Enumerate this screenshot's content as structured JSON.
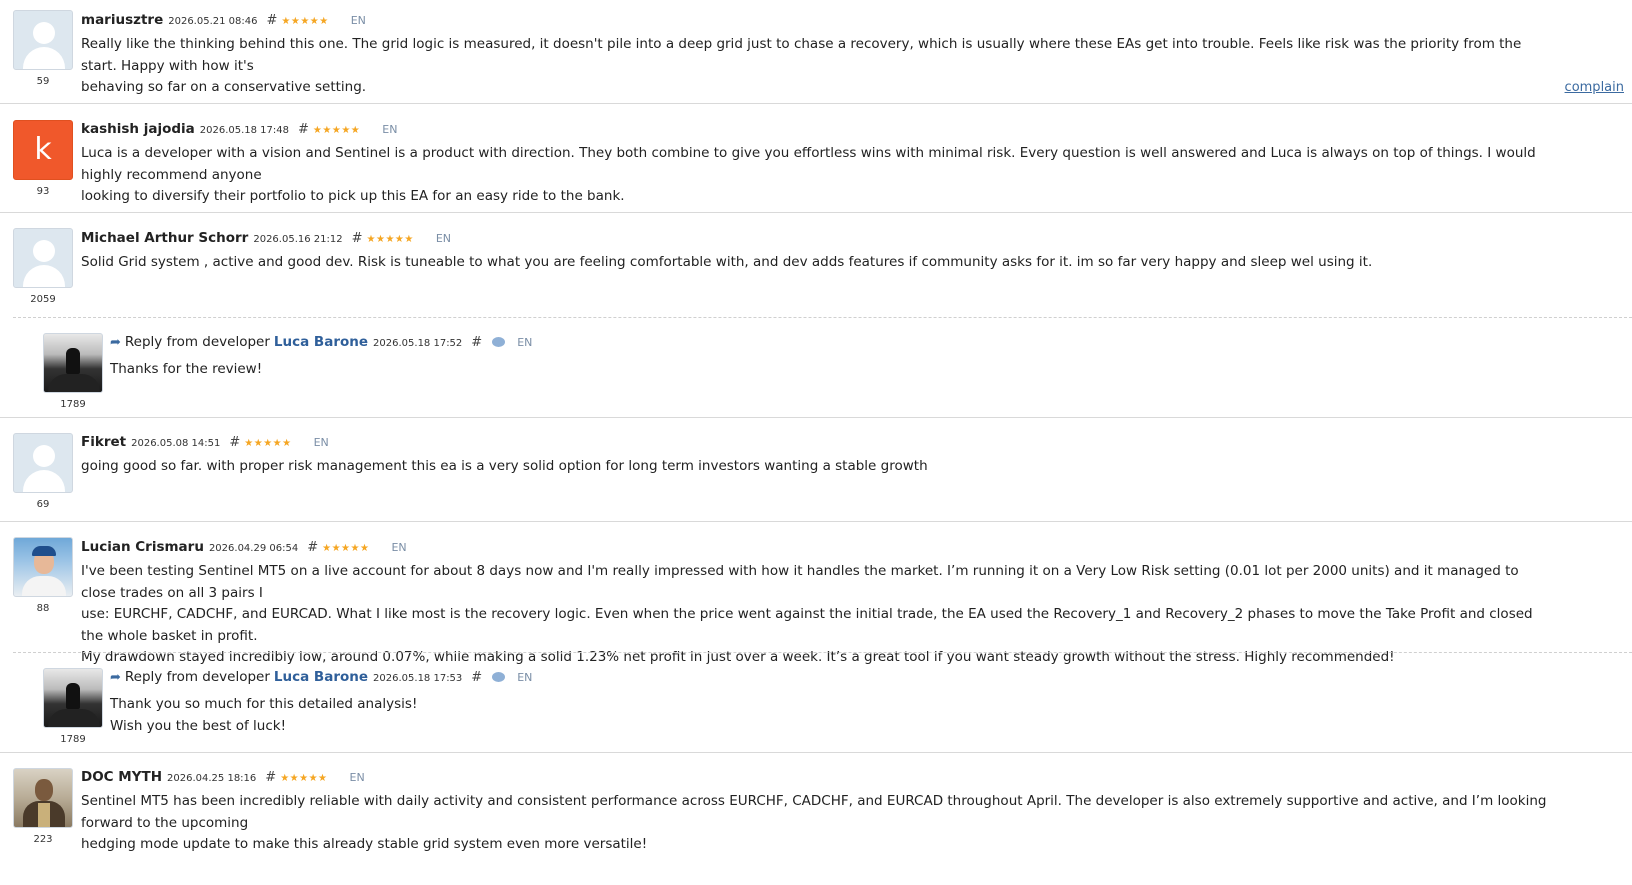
{
  "reviews": [
    {
      "author": "mariusztre",
      "date": "2026.05.21 08:46",
      "hash": "#",
      "stars": "★★★★★",
      "lang": "EN",
      "rating_count": "59",
      "avatar": "placeholder-user-icon",
      "lines": [
        "Really like the thinking behind this one. The grid logic is measured, it doesn't pile into a deep grid just to chase a recovery, which is usually where these EAs get into trouble. Feels like risk was the priority from the start. Happy with how it's",
        "behaving so far on a conservative setting."
      ],
      "complain_label": "complain"
    },
    {
      "author": "kashish jajodia",
      "date": "2026.05.18 17:48",
      "hash": "#",
      "stars": "★★★★★",
      "lang": "EN",
      "rating_count": "93",
      "avatar_letter": "k",
      "lines": [
        "Luca is a developer with a vision and Sentinel is a product with direction. They both combine to give you effortless wins with minimal risk. Every question is well answered and Luca is always on top of things. I would highly recommend anyone",
        "looking to diversify their portfolio to pick up this EA for an easy ride to the bank."
      ]
    },
    {
      "author": "Michael Arthur Schorr",
      "date": "2026.05.16 21:12",
      "hash": "#",
      "stars": "★★★★★",
      "lang": "EN",
      "rating_count": "2059",
      "avatar": "placeholder-user-icon",
      "lines": [
        "Solid Grid system , active and good dev. Risk is tuneable to what you are feeling comfortable with, and dev adds features if community asks for it. im so far very happy and sleep wel using it."
      ],
      "reply": {
        "prefix": "Reply from developer",
        "developer": "Luca Barone",
        "date": "2026.05.18 17:52",
        "hash": "#",
        "lang": "EN",
        "rating_count": "1789",
        "lines": [
          "Thanks for the review!"
        ]
      }
    },
    {
      "author": "Fikret",
      "date": "2026.05.08 14:51",
      "hash": "#",
      "stars": "★★★★★",
      "lang": "EN",
      "rating_count": "69",
      "avatar": "placeholder-user-icon",
      "lines": [
        "going good so far. with proper risk management this ea is a very solid option for long term investors wanting a stable growth"
      ]
    },
    {
      "author": "Lucian Crismaru",
      "date": "2026.04.29 06:54",
      "hash": "#",
      "stars": "★★★★★",
      "lang": "EN",
      "rating_count": "88",
      "lines": [
        "I've been testing Sentinel MT5 on a live account for about 8 days now and I'm really impressed with how it handles the market. I’m running it on a Very Low Risk setting (0.01 lot per 2000 units) and it managed to close trades on all 3 pairs I",
        "use: EURCHF, CADCHF, and EURCAD. What I like most is the recovery logic. Even when the price went against the initial trade, the EA used the Recovery_1 and Recovery_2 phases to move the Take Profit and closed the whole basket in profit.",
        "My drawdown stayed incredibly low, around 0.07%, while making a solid 1.23% net profit in just over a week. It’s a great tool if you want steady growth without the stress. Highly recommended!"
      ],
      "reply": {
        "prefix": "Reply from developer",
        "developer": "Luca Barone",
        "date": "2026.05.18 17:53",
        "hash": "#",
        "lang": "EN",
        "rating_count": "1789",
        "lines": [
          "Thank you so much for this detailed analysis!",
          "Wish you the best of luck!"
        ]
      }
    },
    {
      "author": "DOC MYTH",
      "date": "2026.04.25 18:16",
      "hash": "#",
      "stars": "★★★★★",
      "lang": "EN",
      "rating_count": "223",
      "lines": [
        "Sentinel MT5 has been incredibly reliable with daily activity and consistent performance across EURCHF, CADCHF, and EURCAD throughout April. The developer is also extremely supportive and active, and I’m looking forward to the upcoming",
        "hedging mode update to make this already stable grid system even more versatile!"
      ]
    }
  ],
  "colors": {
    "accent_link": "#3b6aa0",
    "stars": "#f5a623",
    "lang": "#7a8ea6"
  }
}
